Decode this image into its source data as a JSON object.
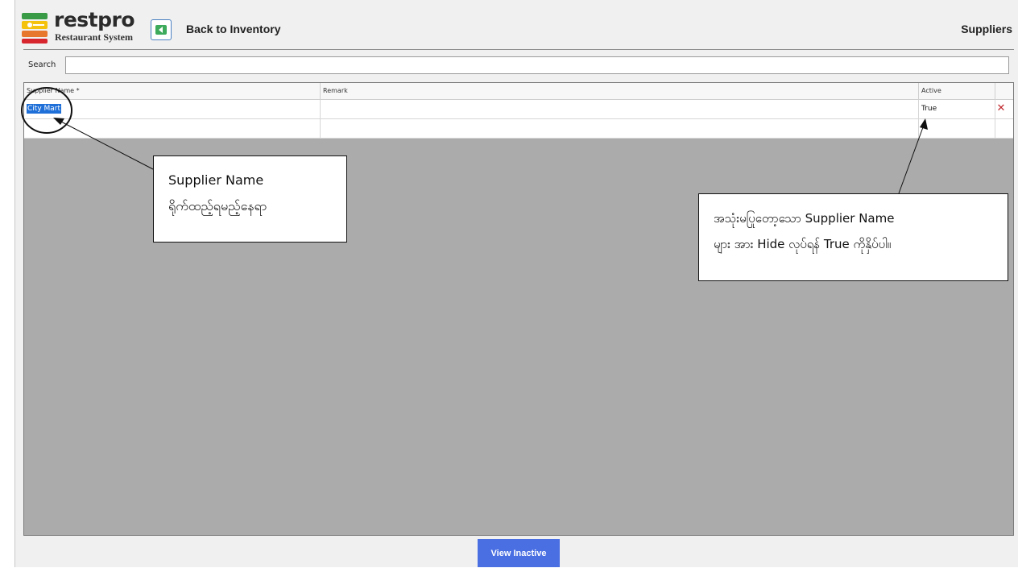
{
  "header": {
    "logo_name": "restpro",
    "logo_subtitle": "Restaurant System",
    "back_label": "Back to Inventory",
    "page_title": "Suppliers"
  },
  "search": {
    "label": "Search",
    "value": ""
  },
  "grid": {
    "columns": [
      "Supplier Name *",
      "Remark",
      "Active"
    ],
    "rows": [
      {
        "supplier_name": "City Mart",
        "remark": "",
        "active": "True"
      }
    ]
  },
  "footer": {
    "view_inactive_label": "View Inactive"
  },
  "annotations": {
    "callout1_line1": "Supplier Name",
    "callout1_line2": "ရိုက်ထည့်ရမည့်နေရာ",
    "callout2_line1": "အသုံးမပြုတော့သော Supplier Name",
    "callout2_line2": "များ အား Hide လုပ်ရန် True ကိုနှိပ်ပါ။"
  },
  "colors": {
    "grid_background": "#ababab",
    "primary_button": "#4a6fe3",
    "delete_icon": "#c0282e",
    "selection": "#1e6fd8"
  }
}
